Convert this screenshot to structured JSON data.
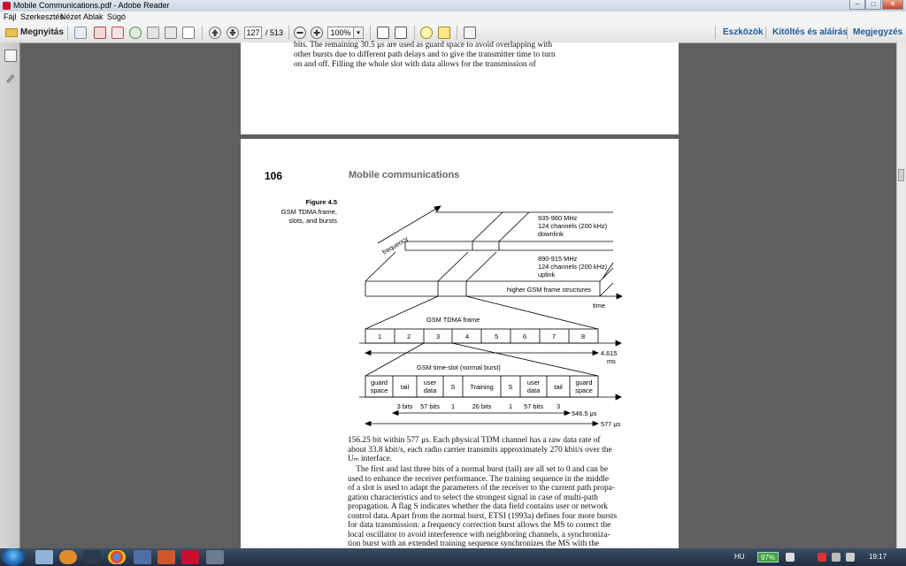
{
  "window": {
    "title": "Mobile Communications.pdf - Adobe Reader",
    "min_label": "–",
    "max_label": "□",
    "close_label": "✕"
  },
  "menu": [
    "Fájl",
    "Szerkesztés",
    "Nézet",
    "Ablak",
    "Súgó"
  ],
  "toolbar": {
    "open_label": "Megnyitás",
    "page_current": "127",
    "page_total": "/ 513",
    "zoom": "100%",
    "zoom_dropdown": "▾",
    "right_links": [
      "Eszközök",
      "Kitöltés és aláírás",
      "Megjegyzés"
    ],
    "icons": [
      "create-pdf-icon",
      "convert-icon",
      "edit-icon",
      "upload-icon",
      "save-icon",
      "print-icon",
      "email-icon",
      "prev-page-icon",
      "next-page-icon",
      "zoom-out-icon",
      "zoom-in-icon",
      "fit-page-icon",
      "fit-width-icon",
      "comment-icon",
      "highlight-icon",
      "expand-icon"
    ]
  },
  "prev_page": {
    "lines": [
      "bits. The remaining 30.5 μs are used as guard space to avoid overlapping with",
      "other bursts due to different path delays and to give the transmitter time to turn",
      "on and off. Filling the whole slot with data allows for the transmission of"
    ]
  },
  "page": {
    "number": "106",
    "running_head": "Mobile communications",
    "figure_label": "Figure 4.5",
    "figure_caption": [
      "GSM TDMA frame,",
      "slots, and bursts"
    ]
  },
  "figure": {
    "axis_frequency": "frequency",
    "axis_time": "time",
    "downlink": [
      "935-960 MHz",
      "124 channels (200 kHz)",
      "downlink"
    ],
    "uplink": [
      "890-915 MHz",
      "124 channels (200 kHz)",
      "uplink"
    ],
    "higher": "higher GSM frame structures",
    "frame_title": "GSM TDMA frame",
    "slots": [
      "1",
      "2",
      "3",
      "4",
      "5",
      "6",
      "7",
      "8"
    ],
    "frame_duration": [
      "4.615",
      "ms"
    ],
    "burst_title": "GSM time-slot (normal burst)",
    "burst_fields": [
      [
        "guard",
        "space"
      ],
      [
        "tail"
      ],
      [
        "user",
        "data"
      ],
      [
        "S"
      ],
      [
        "Training"
      ],
      [
        "S"
      ],
      [
        "user",
        "data"
      ],
      [
        "tail"
      ],
      [
        "guard",
        "space"
      ]
    ],
    "bits": [
      "3 bits",
      "57 bits",
      "1",
      "26 bits",
      "1",
      "57 bits",
      "3"
    ],
    "burst_duration": "546.5 μs",
    "slot_duration": "577 μs"
  },
  "body": {
    "lines": [
      "156.25 bit within 577 μs. Each physical TDM channel has a raw data rate of",
      "about 33.8 kbit/s, each radio carrier transmits approximately 270 kbit/s over the",
      "Uₘ interface.",
      "    The first and last three bits of a normal burst (tail) are all set to 0 and can be",
      "used to enhance the receiver performance. The training sequence in the middle",
      "of a slot is used to adapt the parameters of the receiver to the current path propa-",
      "gation characteristics and to select the strongest signal in case of multi-path",
      "propagation. A flag S indicates whether the data field contains user or network",
      "control data. Apart from the normal burst, ETSI (1993a) defines four more bursts",
      "for data transmission: a frequency correction burst allows the MS to correct the",
      "local oscillator to avoid interference with neighboring channels, a synchroniza-",
      "tion burst with an extended training sequence synchronizes the MS with the"
    ]
  },
  "taskbar": {
    "lang": "HU",
    "battery": "97%",
    "clock": "19:17"
  }
}
